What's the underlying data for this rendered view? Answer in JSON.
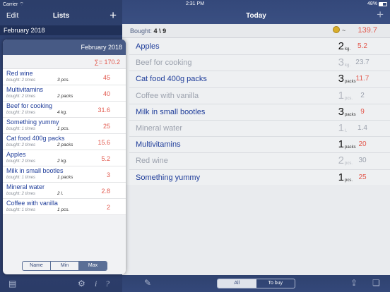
{
  "status": {
    "carrier": "Carrier",
    "time": "2:31 PM",
    "battery": "48%",
    "battery_level": 0.48
  },
  "sidebar": {
    "edit_label": "Edit",
    "title": "Lists",
    "plus_label": "+",
    "month": "February 2018"
  },
  "popover": {
    "month": "February 2018",
    "sum": "∑= 170.2",
    "items": [
      {
        "name": "Red wine",
        "bought": "bought: 2 times",
        "qty": "3 pcs.",
        "price": "45"
      },
      {
        "name": "Multivitamins",
        "bought": "bought: 2 times",
        "qty": "2 packs",
        "price": "40"
      },
      {
        "name": "Beef for cooking",
        "bought": "bought: 2 times",
        "qty": "4 kg.",
        "price": "31.6"
      },
      {
        "name": "Something yummy",
        "bought": "bought: 1 times",
        "qty": "1 pcs.",
        "price": "25"
      },
      {
        "name": "Cat food 400g packs",
        "bought": "bought: 2 times",
        "qty": "2 packs",
        "price": "15.6"
      },
      {
        "name": "Apples",
        "bought": "bought: 2 times",
        "qty": "2 kg.",
        "price": "5.2"
      },
      {
        "name": "Milk in small bootles",
        "bought": "bought: 1 times",
        "qty": "1 packs",
        "price": "3"
      },
      {
        "name": "Mineral water",
        "bought": "bought: 2 times",
        "qty": "2 l.",
        "price": "2.8"
      },
      {
        "name": "Coffee with vanilla",
        "bought": "bought: 1 times",
        "qty": "1 pcs.",
        "price": "2"
      }
    ],
    "sort": [
      "Name",
      "Min",
      "Max"
    ],
    "sort_active": 2
  },
  "main": {
    "title": "Today",
    "plus_label": "+",
    "bought_label": "Bought:",
    "bought_done": "4",
    "bought_sep": "\\",
    "bought_total": "9",
    "tilde": "~",
    "total": "139.7",
    "items": [
      {
        "name": "Apples",
        "qty": "2",
        "unit": "kg.",
        "price": "5.2",
        "done": false
      },
      {
        "name": "Beef for cooking",
        "qty": "3",
        "unit": "kg.",
        "price": "23.7",
        "done": true
      },
      {
        "name": "Cat food 400g packs",
        "qty": "3",
        "unit": "packs",
        "price": "11.7",
        "done": false
      },
      {
        "name": "Coffee with vanilla",
        "qty": "1",
        "unit": "pcs.",
        "price": "2",
        "done": true
      },
      {
        "name": "Milk in small bootles",
        "qty": "3",
        "unit": "packs",
        "price": "9",
        "done": false
      },
      {
        "name": "Mineral water",
        "qty": "1",
        "unit": "l.",
        "price": "1.4",
        "done": true
      },
      {
        "name": "Multivitamins",
        "qty": "1",
        "unit": "packs",
        "price": "20",
        "done": false
      },
      {
        "name": "Red wine",
        "qty": "2",
        "unit": "pcs.",
        "price": "30",
        "done": true
      },
      {
        "name": "Something yummy",
        "qty": "1",
        "unit": "pcs.",
        "price": "25",
        "done": false
      }
    ],
    "filter": [
      "All",
      "To buy"
    ],
    "filter_active": 0
  },
  "toolbar": {
    "info_label": "i",
    "help_label": "?"
  },
  "icons": {
    "wifi": "wifi-icon",
    "list": "list-icon",
    "settings": "gear-icon",
    "info": "info-icon",
    "help": "help-icon",
    "edit": "pencil-icon",
    "share": "share-icon",
    "book": "book-icon",
    "coin": "coins-icon"
  },
  "colors": {
    "accent": "#34487a",
    "price": "#e2584d",
    "name": "#1f3d9a",
    "muted": "#9ba1ad"
  }
}
